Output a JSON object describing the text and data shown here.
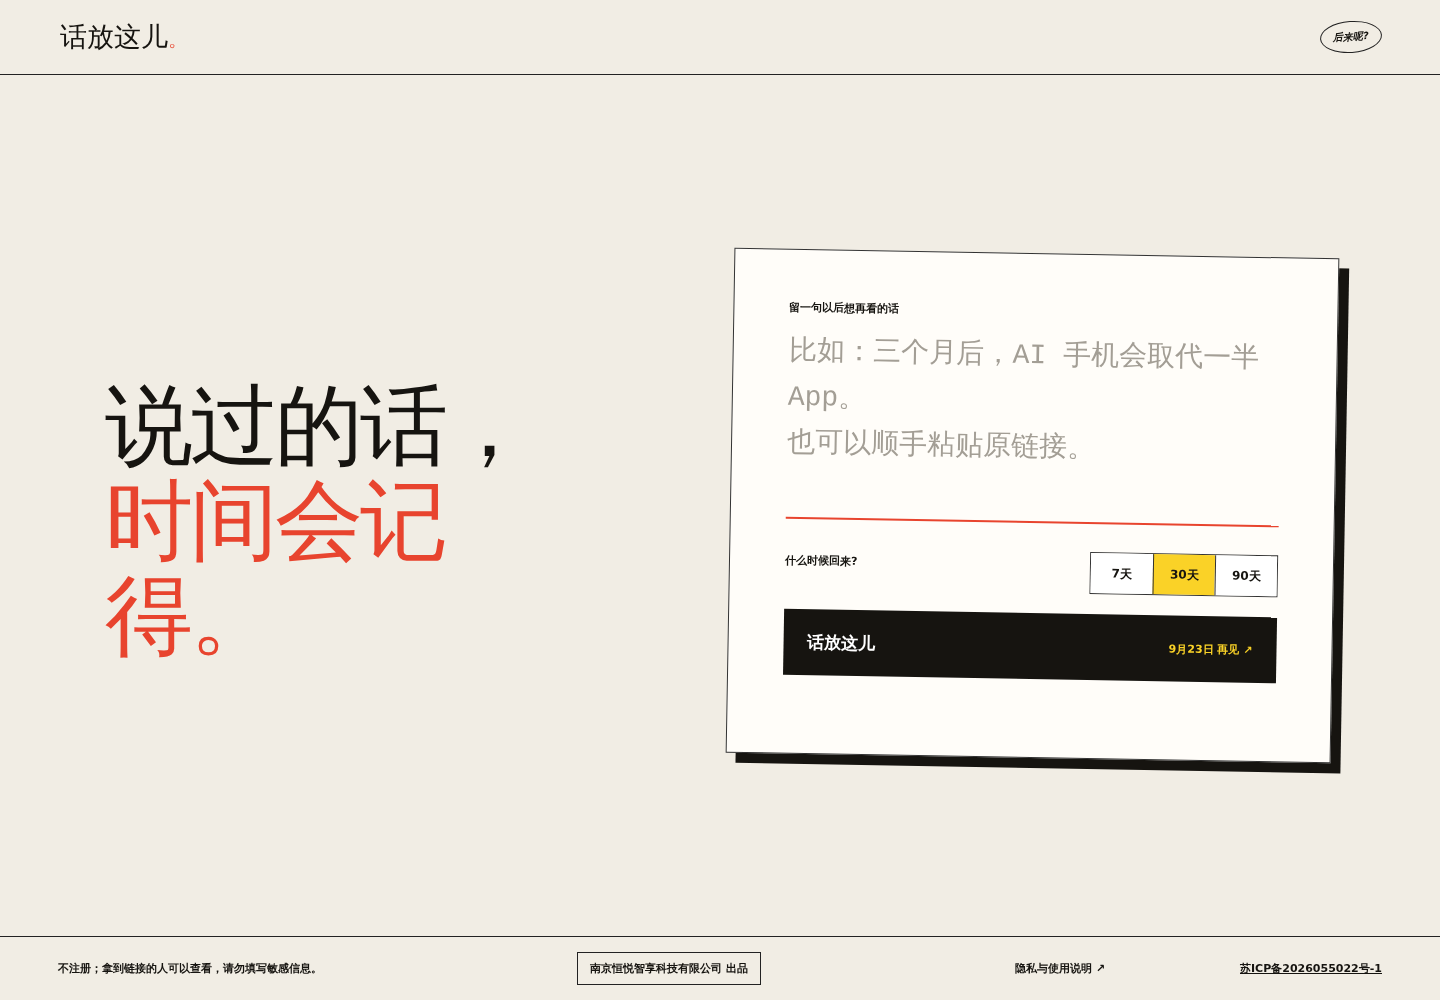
{
  "header": {
    "brand": {
      "name": "话放这儿",
      "dot": "。"
    },
    "about_button": "后来呢?"
  },
  "headline": [
    {
      "text": "说过的话，",
      "kind": "plain"
    },
    {
      "text": "时间会记得。",
      "kind": "accent"
    }
  ],
  "card": {
    "label": "留一句以后想再看的话",
    "placeholder": [
      "比如：三个月后，AI 手机会取代一半 App。",
      "也可以顺手粘贴原链接。"
    ],
    "duration_label": "什么时候回来?",
    "durations": [
      {
        "label": "7天",
        "selected": false
      },
      {
        "label": "30天",
        "selected": true
      },
      {
        "label": "90天",
        "selected": false
      }
    ],
    "submit": {
      "label": "话放这儿",
      "note": "9月23日 再见 ↗"
    }
  },
  "footer": {
    "notice": "不注册；拿到链接的人可以查看，请勿填写敏感信息。",
    "maker": "南京恒悦智享科技有限公司 出品",
    "privacy_link": "隐私与使用说明 ↗",
    "icp_link": "苏ICP备2026055022号-1"
  }
}
